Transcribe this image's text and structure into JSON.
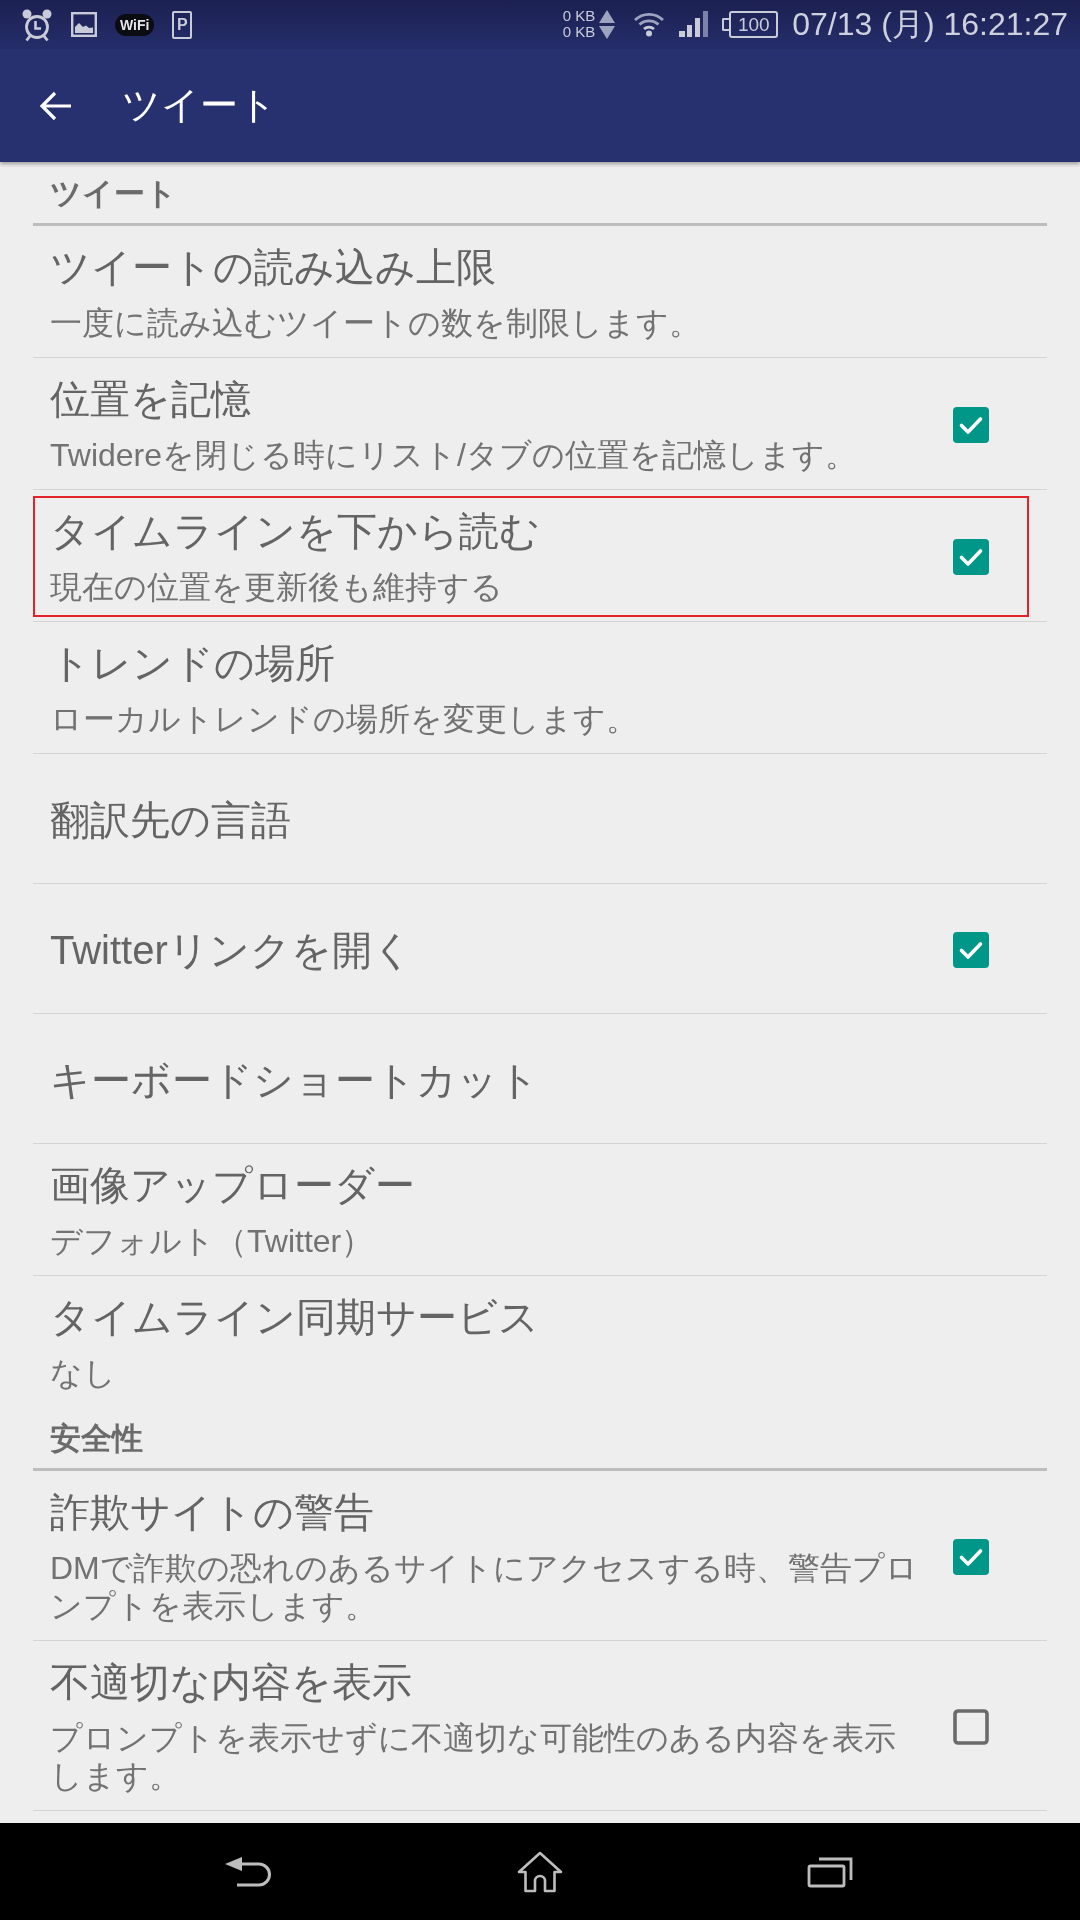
{
  "status_bar": {
    "notification_badges": [
      "WiFi",
      "P"
    ],
    "upload_rate": "0 KB",
    "download_rate": "0 KB",
    "battery": "100",
    "clock": "07/13 (月) 16:21:27"
  },
  "app_bar": {
    "title": "ツイート"
  },
  "sections": [
    {
      "title": "ツイート",
      "items": [
        {
          "kind": "plain",
          "title": "ツイートの読み込み上限",
          "summary": "一度に読み込むツイートの数を制限します。",
          "highlighted": false
        },
        {
          "kind": "checkbox",
          "title": "位置を記憶",
          "summary": "Twidereを閉じる時にリスト/タブの位置を記憶します。",
          "checked": true,
          "highlighted": false
        },
        {
          "kind": "checkbox",
          "title": "タイムラインを下から読む",
          "summary": "現在の位置を更新後も維持する",
          "checked": true,
          "highlighted": true
        },
        {
          "kind": "plain",
          "title": "トレンドの場所",
          "summary": "ローカルトレンドの場所を変更します。",
          "highlighted": false
        },
        {
          "kind": "plain",
          "title": "翻訳先の言語",
          "highlighted": false
        },
        {
          "kind": "checkbox",
          "title": "Twitterリンクを開く",
          "checked": true,
          "highlighted": false
        },
        {
          "kind": "plain",
          "title": "キーボードショートカット",
          "highlighted": false
        },
        {
          "kind": "plain",
          "title": "画像アップローダー",
          "summary": "デフォルト（Twitter）",
          "highlighted": false
        },
        {
          "kind": "plain",
          "title": "タイムライン同期サービス",
          "summary": "なし",
          "highlighted": false
        }
      ]
    },
    {
      "title": "安全性",
      "items": [
        {
          "kind": "checkbox",
          "title": "詐欺サイトの警告",
          "summary": "DMで詐欺の恐れのあるサイトにアクセスする時、警告プロンプトを表示します。",
          "checked": true,
          "highlighted": false
        },
        {
          "kind": "checkbox",
          "title": "不適切な内容を表示",
          "summary": "プロンプトを表示せずに不適切な可能性のある内容を表示します。",
          "checked": false,
          "highlighted": false
        }
      ]
    }
  ]
}
